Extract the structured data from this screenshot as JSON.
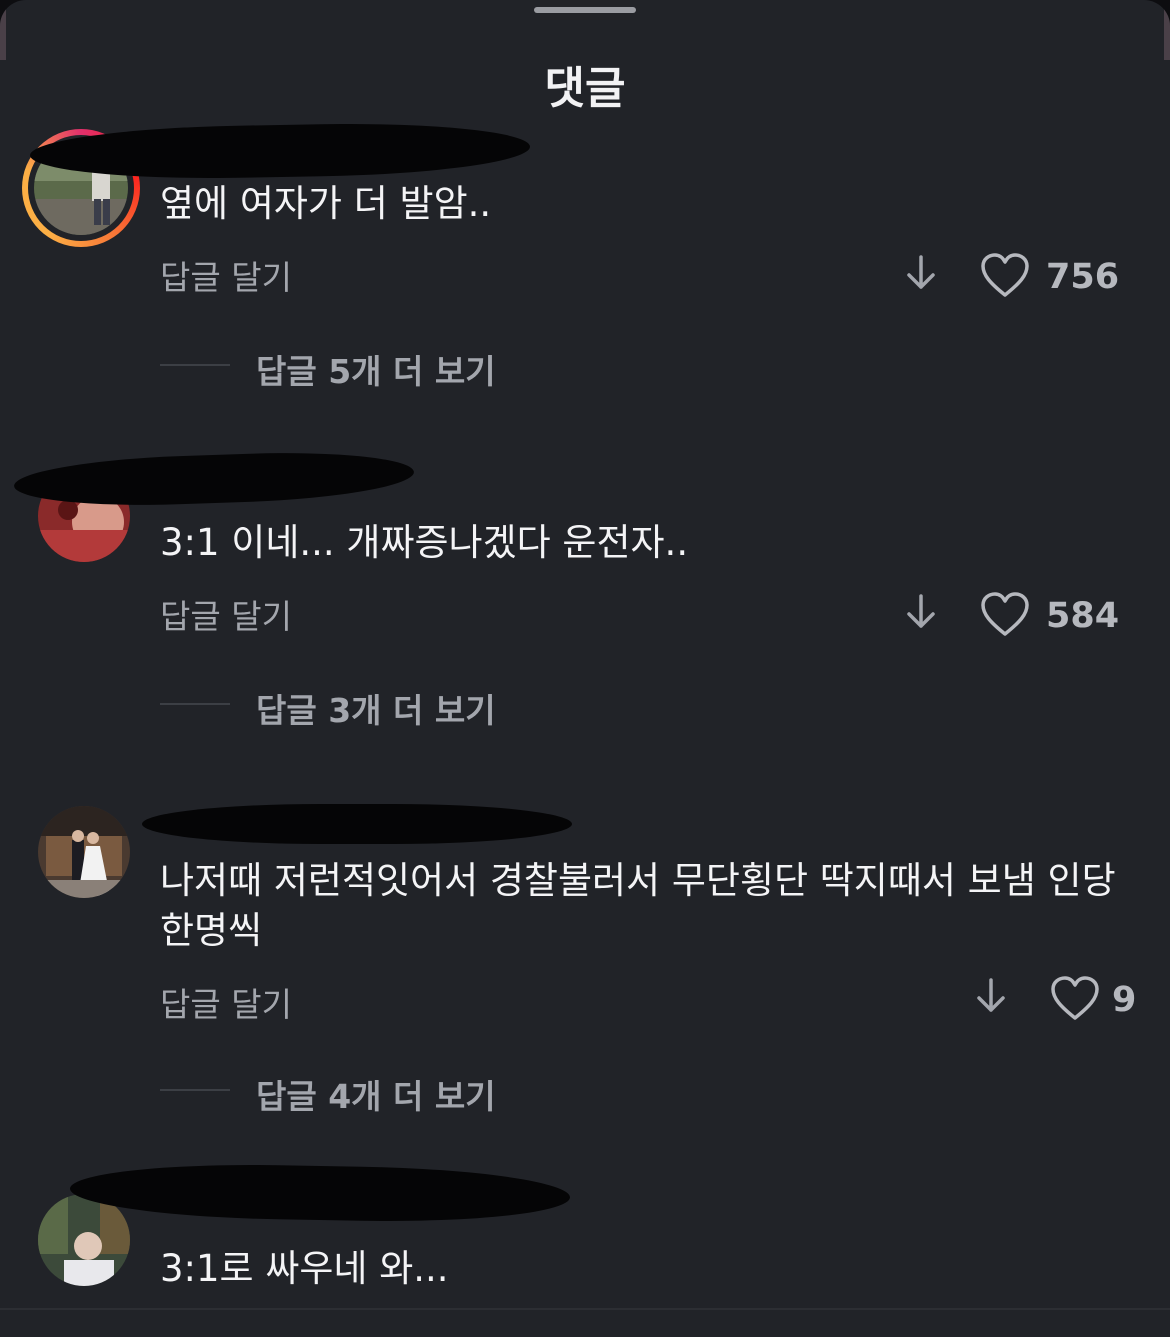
{
  "sheet": {
    "title": "댓글"
  },
  "comments": [
    {
      "text": "옆에 여자가 더 발암..",
      "reply_label": "답글 달기",
      "like_count": "756",
      "view_replies": "답글 5개 더 보기",
      "has_story_ring": true
    },
    {
      "text": "3:1  이네... 개짜증나겠다 운전자..",
      "reply_label": "답글 달기",
      "like_count": "584",
      "view_replies": "답글 3개 더 보기",
      "has_story_ring": false
    },
    {
      "text": "나저때 저런적잇어서 경찰불러서 무단횡단 딱지때서 보냄 인당 한명씩",
      "reply_label": "답글 달기",
      "like_count": "9",
      "view_replies": "답글 4개 더 보기",
      "has_story_ring": false
    },
    {
      "text": "3:1로 싸우네 와...",
      "has_story_ring": false
    }
  ],
  "icons": {
    "down": "arrow-down-icon",
    "like": "heart-icon"
  },
  "colors": {
    "background": "#212328",
    "text_primary": "#f4f4f6",
    "text_secondary": "#a3a6ad",
    "story_ring": [
      "#e1306c",
      "#f77737",
      "#fcaf45"
    ]
  }
}
